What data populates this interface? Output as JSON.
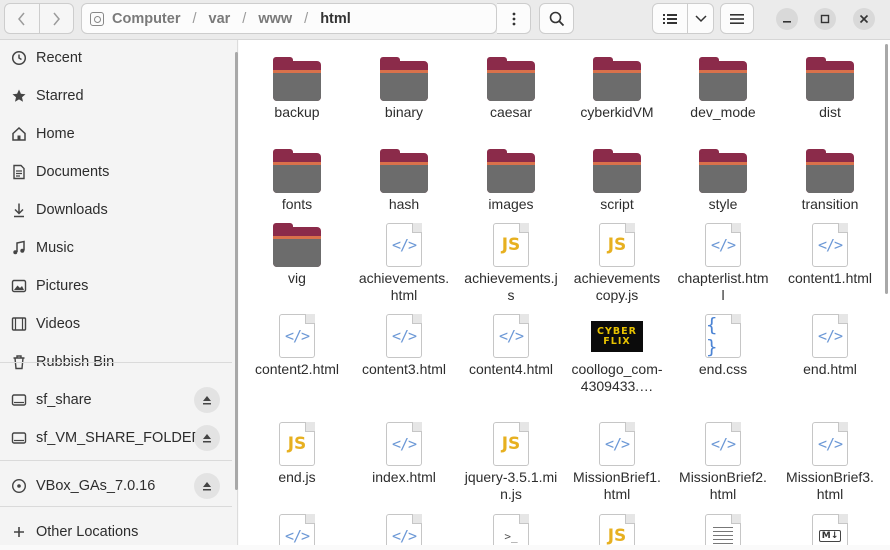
{
  "header": {
    "path": [
      "Computer",
      "var",
      "www",
      "html"
    ],
    "icons": {
      "back": "chevron-left-icon",
      "forward": "chevron-right-icon",
      "drive": "drive-icon",
      "path_menu": "vertical-dots-icon",
      "search": "search-icon",
      "view_list": "list-view-icon",
      "view_dropdown": "chevron-down-icon",
      "main_menu": "hamburger-icon",
      "minimize": "minimize-icon",
      "maximize": "maximize-icon",
      "close": "close-icon"
    }
  },
  "sidebar": {
    "items": [
      {
        "label": "Recent",
        "icon": "clock-icon"
      },
      {
        "label": "Starred",
        "icon": "star-icon"
      },
      {
        "label": "Home",
        "icon": "home-icon"
      },
      {
        "label": "Documents",
        "icon": "document-icon"
      },
      {
        "label": "Downloads",
        "icon": "download-icon"
      },
      {
        "label": "Music",
        "icon": "music-icon"
      },
      {
        "label": "Pictures",
        "icon": "picture-icon"
      },
      {
        "label": "Videos",
        "icon": "video-icon"
      },
      {
        "label": "Rubbish Bin",
        "icon": "trash-icon"
      },
      {
        "label": "sf_share",
        "icon": "drive-icon"
      },
      {
        "label": "sf_VM_SHARE_FOLDER",
        "icon": "drive-icon"
      },
      {
        "label": "VBox_GAs_7.0.16",
        "icon": "disc-icon"
      },
      {
        "label": "Other Locations",
        "icon": "plus-icon"
      }
    ]
  },
  "files": [
    {
      "name": "backup",
      "type": "folder"
    },
    {
      "name": "binary",
      "type": "folder"
    },
    {
      "name": "caesar",
      "type": "folder"
    },
    {
      "name": "cyberkidVM",
      "type": "folder"
    },
    {
      "name": "dev_mode",
      "type": "folder"
    },
    {
      "name": "dist",
      "type": "folder"
    },
    {
      "name": "fonts",
      "type": "folder"
    },
    {
      "name": "hash",
      "type": "folder"
    },
    {
      "name": "images",
      "type": "folder"
    },
    {
      "name": "script",
      "type": "folder"
    },
    {
      "name": "style",
      "type": "folder"
    },
    {
      "name": "transition",
      "type": "folder"
    },
    {
      "name": "vig",
      "type": "folder"
    },
    {
      "name": "achievements.html",
      "type": "html"
    },
    {
      "name": "achievements.js",
      "type": "js"
    },
    {
      "name": "achievements copy.js",
      "type": "js"
    },
    {
      "name": "chapterlist.html",
      "type": "html"
    },
    {
      "name": "content1.html",
      "type": "html"
    },
    {
      "name": "content2.html",
      "type": "html"
    },
    {
      "name": "content3.html",
      "type": "html"
    },
    {
      "name": "content4.html",
      "type": "html"
    },
    {
      "name": "coollogo_com-4309433.…",
      "type": "image",
      "thumb_text": [
        "CYBER",
        "FLIX"
      ]
    },
    {
      "name": "end.css",
      "type": "css"
    },
    {
      "name": "end.html",
      "type": "html"
    },
    {
      "name": "end.js",
      "type": "js"
    },
    {
      "name": "index.html",
      "type": "html"
    },
    {
      "name": "jquery-3.5.1.min.js",
      "type": "js"
    },
    {
      "name": "MissionBrief1.html",
      "type": "html"
    },
    {
      "name": "MissionBrief2.html",
      "type": "html"
    },
    {
      "name": "MissionBrief3.html",
      "type": "html"
    },
    {
      "name": "",
      "type": "html"
    },
    {
      "name": "",
      "type": "html"
    },
    {
      "name": "",
      "type": "script"
    },
    {
      "name": "",
      "type": "js"
    },
    {
      "name": "",
      "type": "text"
    },
    {
      "name": "",
      "type": "markdown"
    }
  ]
}
